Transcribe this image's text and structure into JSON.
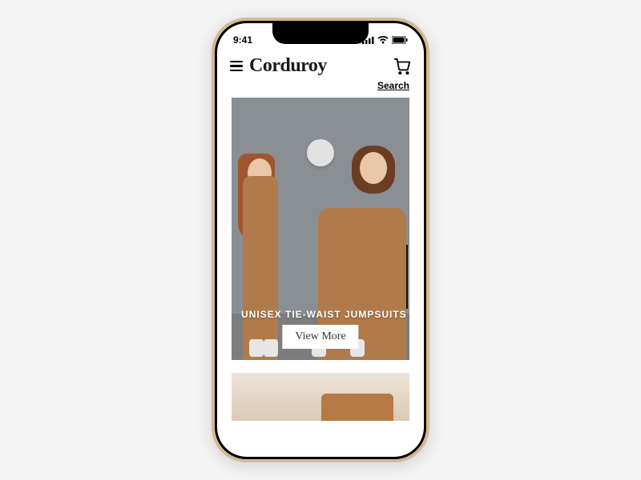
{
  "status": {
    "time": "9:41"
  },
  "header": {
    "brand": "Corduroy"
  },
  "search": {
    "label": "Search"
  },
  "hero": {
    "caption": "UNISEX TIE-WAIST JUMPSUITS",
    "cta_label": "View More"
  }
}
